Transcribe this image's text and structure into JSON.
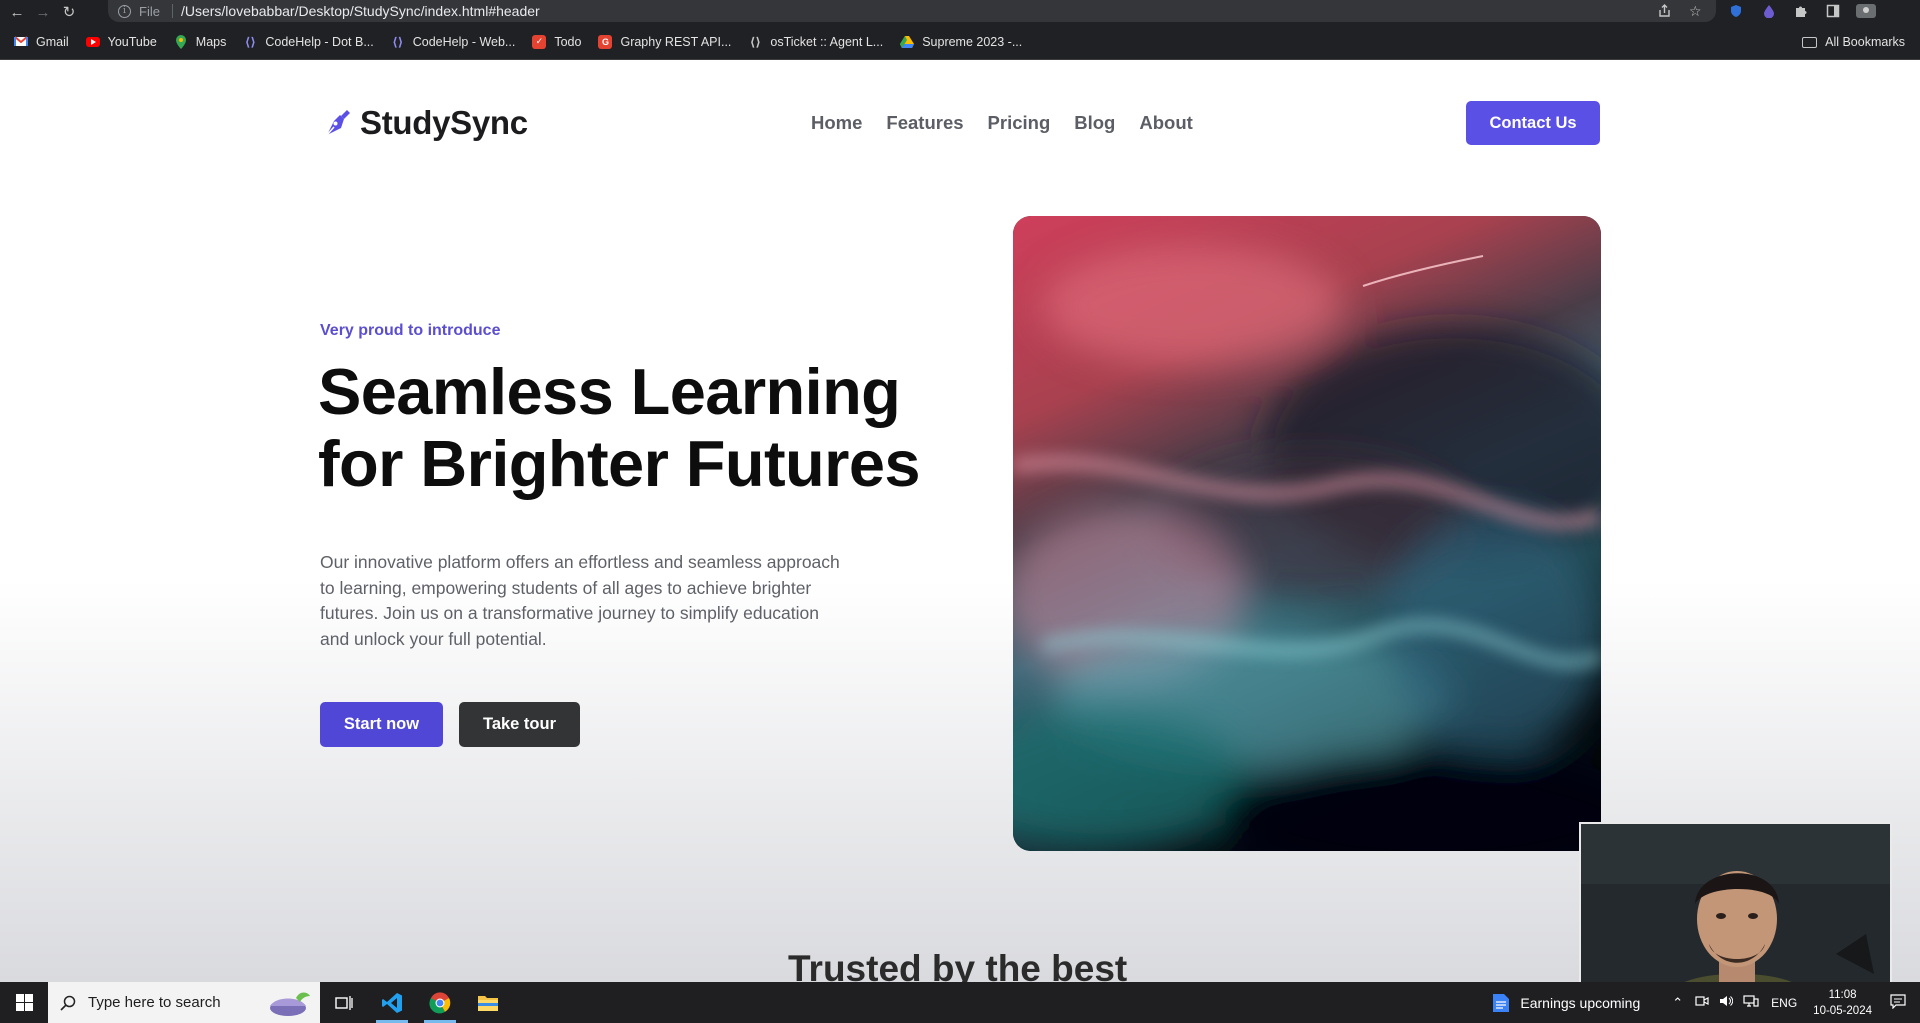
{
  "browser": {
    "url_scheme": "File",
    "url_path": "/Users/lovebabbar/Desktop/StudySync/index.html#header",
    "bookmarks": [
      {
        "label": "Gmail",
        "icon": "gmail-icon",
        "color": "#ea4335"
      },
      {
        "label": "YouTube",
        "icon": "youtube-icon",
        "color": "#ff0000"
      },
      {
        "label": "Maps",
        "icon": "maps-icon",
        "color": "#34a853"
      },
      {
        "label": "CodeHelp - Dot B...",
        "icon": "codehelp-icon",
        "color": "#6f6cde"
      },
      {
        "label": "CodeHelp - Web...",
        "icon": "codehelp-icon",
        "color": "#6f6cde"
      },
      {
        "label": "Todo",
        "icon": "todo-icon",
        "color": "#e44332"
      },
      {
        "label": "Graphy REST API...",
        "icon": "graphy-icon",
        "color": "#e44332"
      },
      {
        "label": "osTicket :: Agent L...",
        "icon": "osticket-icon",
        "color": "#9aa0a6"
      },
      {
        "label": "Supreme 2023 -...",
        "icon": "drive-icon",
        "color": "#fbbc04"
      }
    ],
    "all_bookmarks": "All Bookmarks"
  },
  "site": {
    "brand": "StudySync",
    "nav": [
      "Home",
      "Features",
      "Pricing",
      "Blog",
      "About"
    ],
    "contact_button": "Contact Us",
    "eyebrow": "Very proud to introduce",
    "headline_line1": "Seamless Learning",
    "headline_line2": "for Brighter Futures",
    "description": "Our innovative platform offers an effortless and seamless approach to learning, empowering students of all ages to achieve brighter futures. Join us on a transformative journey to simplify education and unlock your full potential.",
    "start_button": "Start now",
    "tour_button": "Take tour",
    "trusted_heading": "Trusted by the best",
    "accent_color": "#5b50e6"
  },
  "taskbar": {
    "search_placeholder": "Type here to search",
    "news_label": "Earnings upcoming",
    "language": "ENG",
    "time": "11:08",
    "date": "10-05-2024"
  }
}
